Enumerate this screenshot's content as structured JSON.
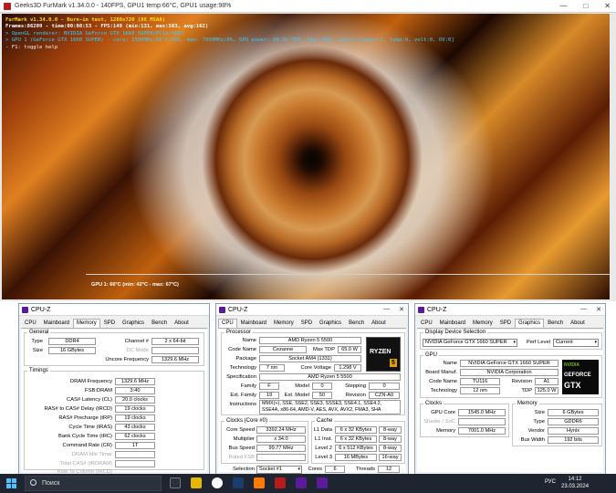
{
  "furmark": {
    "title": "Geeks3D FurMark v1.34.0.0 - 140FPS, GPU1 temp:66°C, GPU1 usage:98%",
    "overlay": {
      "line1": "FurMark v1.34.0.0 - Burn-in test, 1280x720 (8X MSAA)",
      "line2": "Frames:86209 - time:00:08:53 - FPS:149 (min:131, max:583, avg:162)",
      "line3": "> OpenGL renderer: NVIDIA GeForce GTX 1660 SUPER/PCIe/SSE2",
      "line4": "> GPU 1 (GeForce GTX 1660 SUPER) - core: 1590MHz/66°C/98%, mem: 7000MHz/8%, GPU power: 98.9% TDP, fan: 40%, limits:[power:1, temp:0, volt:0, OV:0]",
      "line5": "- F1: toggle help"
    },
    "graph_label": "GPU 1: 66°C (min: 42°C - max: 67°C)"
  },
  "cpuz_memory": {
    "title": "CPU-Z",
    "tabs": [
      "CPU",
      "Mainboard",
      "Memory",
      "SPD",
      "Graphics",
      "Bench",
      "About"
    ],
    "active_tab": "Memory",
    "general": {
      "legend": "General",
      "type_label": "Type",
      "type": "DDR4",
      "size_label": "Size",
      "size": "16 GBytes",
      "channel_label": "Channel #",
      "channel": "2 x 64-bit",
      "dcmode_label": "DC Mode",
      "uncore_label": "Uncore Frequency",
      "uncore": "1329.6 MHz"
    },
    "timings": {
      "legend": "Timings",
      "rows": [
        {
          "label": "DRAM Frequency",
          "value": "1329.6 MHz"
        },
        {
          "label": "FSB:DRAM",
          "value": "3:40"
        },
        {
          "label": "CAS# Latency (CL)",
          "value": "20.0 clocks"
        },
        {
          "label": "RAS# to CAS# Delay (tRCD)",
          "value": "19 clocks"
        },
        {
          "label": "RAS# Precharge (tRP)",
          "value": "19 clocks"
        },
        {
          "label": "Cycle Time (tRAS)",
          "value": "43 clocks"
        },
        {
          "label": "Bank Cycle Time (tRC)",
          "value": "62 clocks"
        },
        {
          "label": "Command Rate (CR)",
          "value": "1T"
        }
      ],
      "disabled": [
        "DRAM Idle Timer",
        "Total CAS# (tRDRAM)",
        "Row To Column (tRCD)"
      ]
    }
  },
  "cpuz_cpu": {
    "title": "CPU-Z",
    "tabs": [
      "CPU",
      "Mainboard",
      "Memory",
      "SPD",
      "Graphics",
      "Bench",
      "About"
    ],
    "active_tab": "CPU",
    "processor": {
      "legend": "Processor",
      "name_label": "Name",
      "name": "AMD Ryzen 5 5500",
      "codename_label": "Code Name",
      "codename": "Cezanne",
      "maxtdp_label": "Max TDP",
      "maxtdp": "65.0 W",
      "package_label": "Package",
      "package": "Socket AM4 (1331)",
      "technology_label": "Technology",
      "technology": "7 nm",
      "corevoltage_label": "Core Voltage",
      "corevoltage": "1.298 V",
      "spec_label": "Specification",
      "spec": "AMD Ryzen 5 5500",
      "family_label": "Family",
      "family": "F",
      "model_label": "Model",
      "model": "0",
      "stepping_label": "Stepping",
      "stepping": "0",
      "extfamily_label": "Ext. Family",
      "extfamily": "19",
      "extmodel_label": "Ext. Model",
      "extmodel": "50",
      "revision_label": "Revision",
      "revision": "CZN-A0",
      "instr_label": "Instructions",
      "instr": "MMX(+), SSE, SSE2, SSE3, SSSE3, SSE4.1, SSE4.2, SSE4A, x86-64, AMD-V, AES, AVX, AVX2, FMA3, SHA",
      "logo_brand": "RYZEN",
      "logo_num": "5"
    },
    "clocks": {
      "legend": "Clocks (Core #0)",
      "corespeed_label": "Core Speed",
      "corespeed": "3392.24 MHz",
      "multiplier_label": "Multiplier",
      "multiplier": "x 34.0",
      "busspeed_label": "Bus Speed",
      "busspeed": "99.77 MHz",
      "ratedfsb_label": "Rated FSB"
    },
    "cache": {
      "legend": "Cache",
      "rows": [
        {
          "label": "L1 Data",
          "size": "6 x 32 KBytes",
          "way": "8-way"
        },
        {
          "label": "L1 Inst.",
          "size": "6 x 32 KBytes",
          "way": "8-way"
        },
        {
          "label": "Level 2",
          "size": "6 x 512 KBytes",
          "way": "8-way"
        },
        {
          "label": "Level 3",
          "size": "16 MBytes",
          "way": "16-way"
        }
      ]
    },
    "bottom": {
      "selection_label": "Selection",
      "selection": "Socket #1",
      "cores_label": "Cores",
      "cores": "6",
      "threads_label": "Threads",
      "threads": "12"
    }
  },
  "cpuz_graphics": {
    "title": "CPU-Z",
    "tabs": [
      "CPU",
      "Mainboard",
      "Memory",
      "SPD",
      "Graphics",
      "Bench",
      "About"
    ],
    "active_tab": "Graphics",
    "display": {
      "legend": "Display Device Selection",
      "device": "NVIDIA GeForce GTX 1660 SUPER",
      "perf_label": "Perf Level",
      "perf": "Current"
    },
    "gpu": {
      "legend": "GPU",
      "name_label": "Name",
      "name": "NVIDIA GeForce GTX 1660 SUPER",
      "board_label": "Board Manuf.",
      "board": "NVIDIA Corporation",
      "codename_label": "Code Name",
      "codename": "TU116",
      "revision_label": "Revision",
      "revision": "A1",
      "technology_label": "Technology",
      "technology": "12 nm",
      "tdp_label": "TDP",
      "tdp": "125.0 W",
      "logo_line1": "NVIDIA",
      "logo_line2": "GEFORCE",
      "logo_line3": "GTX"
    },
    "clocks": {
      "legend": "Clocks",
      "gpucore_label": "GPU Core",
      "gpucore": "1545.0 MHz",
      "shader_label": "Shader / SoC",
      "memory_label": "Memory",
      "memory": "7001.0 MHz"
    },
    "memory": {
      "legend": "Memory",
      "size_label": "Size",
      "size": "6 GBytes",
      "type_label": "Type",
      "type": "GDDR6",
      "vendor_label": "Vendor",
      "vendor": "Hynix",
      "buswidth_label": "Bus Width",
      "buswidth": "192 bits"
    }
  },
  "taskbar": {
    "search_placeholder": "Поиск",
    "lang": "РУС",
    "time": "14:12",
    "date": "23.03.2024",
    "watermark": "Avito"
  }
}
